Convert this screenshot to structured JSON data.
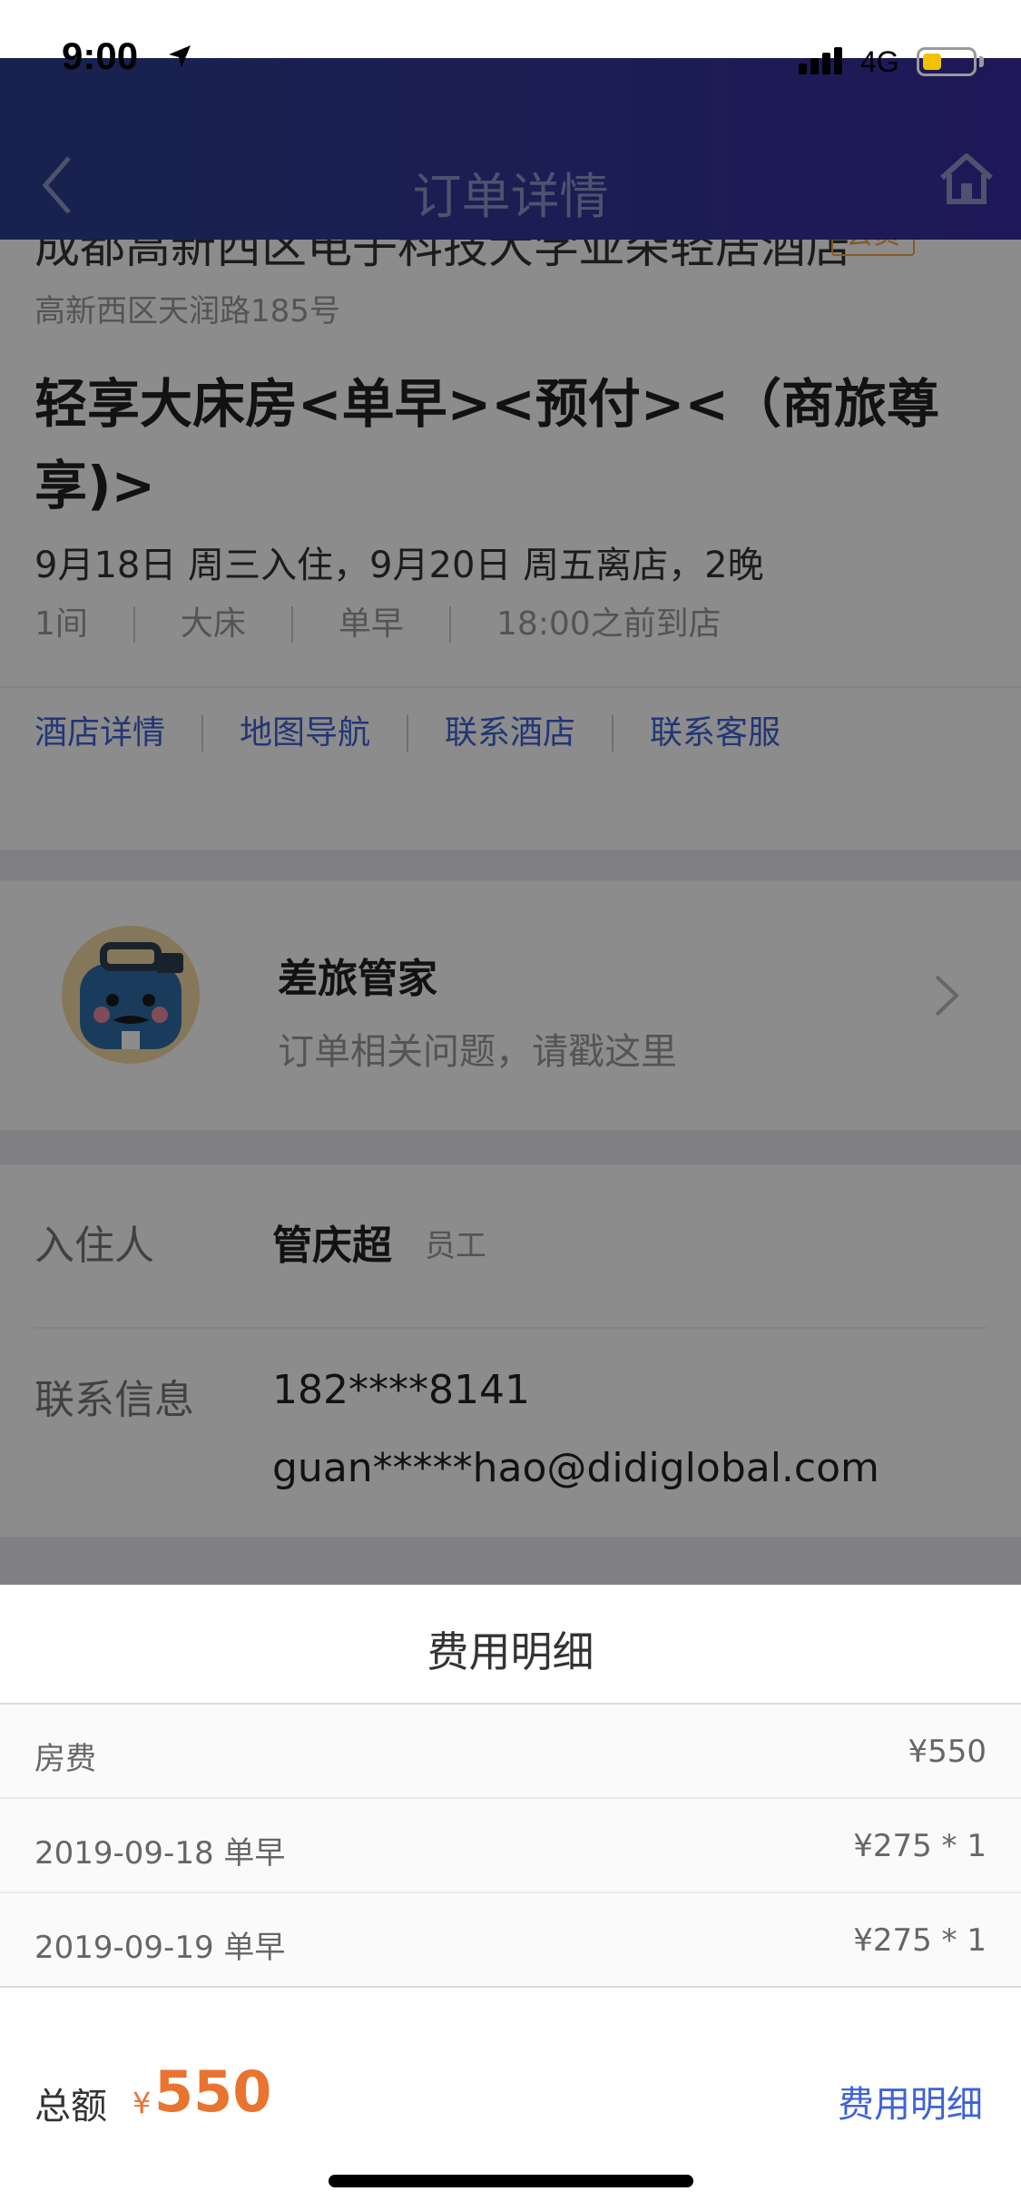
{
  "status_bar": {
    "time": "9:00",
    "network": "4G"
  },
  "nav": {
    "title": "订单详情"
  },
  "hotel": {
    "name": "成都高新西区电子科技大学亚朵轻居酒店",
    "tag": "会员",
    "address": "高新西区天润路185号",
    "room_name": "轻享大床房<单早><预付><（商旅尊享)>",
    "stay_dates": "9月18日 周三入住，9月20日 周五离店，2晚",
    "specs": [
      "1间",
      "大床",
      "单早",
      "18:00之前到店"
    ],
    "links": [
      "酒店详情",
      "地图导航",
      "联系酒店",
      "联系客服"
    ]
  },
  "butler": {
    "title": "差旅管家",
    "subtitle": "订单相关问题，请戳这里"
  },
  "guest": {
    "label": "入住人",
    "name": "管庆超",
    "role": "员工",
    "contact_label": "联系信息",
    "phone": "182****8141",
    "email": "guan*****hao@didiglobal.com"
  },
  "fee_sheet": {
    "title": "费用明细",
    "rows": [
      {
        "label": "房费",
        "value": "¥550"
      },
      {
        "label": "2019-09-18 单早",
        "value": "¥275 * 1"
      },
      {
        "label": "2019-09-19 单早",
        "value": "¥275 * 1"
      }
    ],
    "total_label": "总额",
    "currency": "¥",
    "total_value": "550",
    "detail_link": "费用明细"
  },
  "colors": {
    "accent": "#3f63d6",
    "price": "#e87430",
    "tag": "#f0a53c",
    "nav_bg": "#33359a"
  }
}
